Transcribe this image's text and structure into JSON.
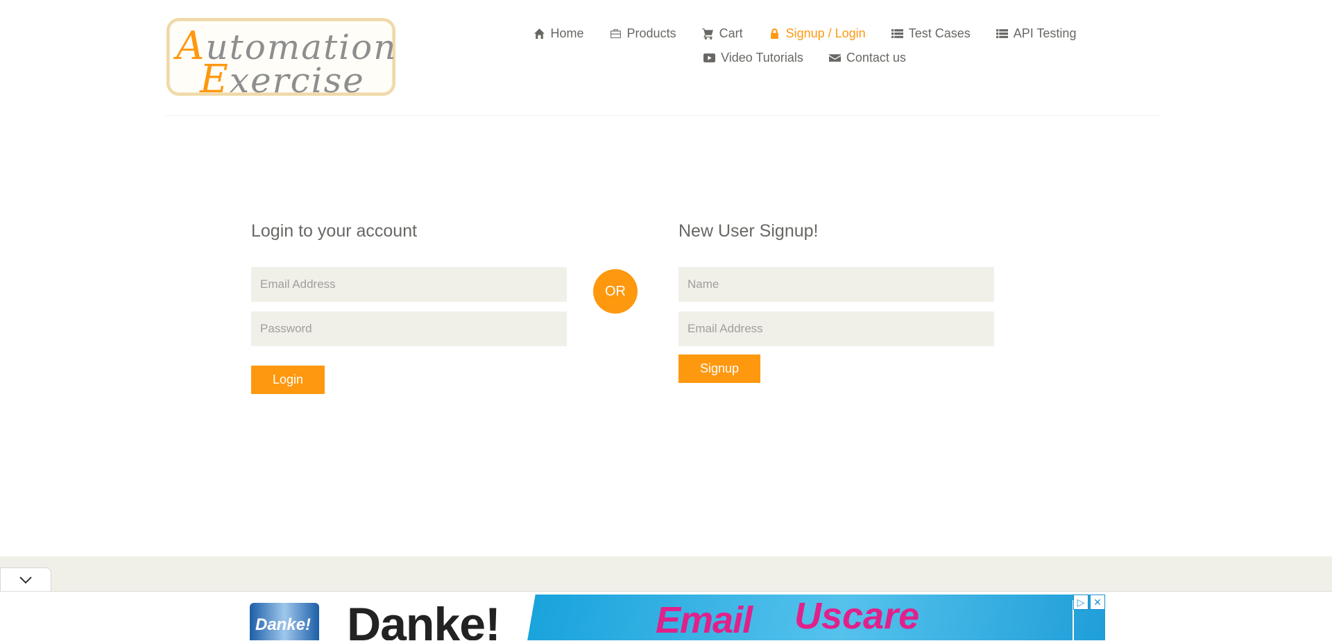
{
  "logo": {
    "line1_cap": "A",
    "line1_rest": "utomation",
    "line2_cap": "E",
    "line2_rest": "xercise"
  },
  "nav": {
    "items": [
      {
        "label": "Home",
        "icon": "home-icon"
      },
      {
        "label": "Products",
        "icon": "briefcase-icon"
      },
      {
        "label": "Cart",
        "icon": "cart-icon"
      },
      {
        "label": "Signup / Login",
        "icon": "lock-icon",
        "active": true
      },
      {
        "label": "Test Cases",
        "icon": "list-icon"
      },
      {
        "label": "API Testing",
        "icon": "list-icon"
      },
      {
        "label": "Video Tutorials",
        "icon": "youtube-play-icon"
      },
      {
        "label": "Contact us",
        "icon": "envelope-icon"
      }
    ]
  },
  "login": {
    "title": "Login to your account",
    "email_placeholder": "Email Address",
    "password_placeholder": "Password",
    "button": "Login"
  },
  "or_label": "OR",
  "signup": {
    "title": "New User Signup!",
    "name_placeholder": "Name",
    "email_placeholder": "Email Address",
    "button": "Signup"
  },
  "ad": {
    "can_text": "Danke!",
    "headline": "Danke!",
    "slogan": "Email",
    "slogan2": "Uscare",
    "controls": [
      "▷",
      "✕"
    ]
  },
  "colors": {
    "accent": "#fe980f",
    "field_bg": "#f0f0e9",
    "text": "#696763"
  }
}
